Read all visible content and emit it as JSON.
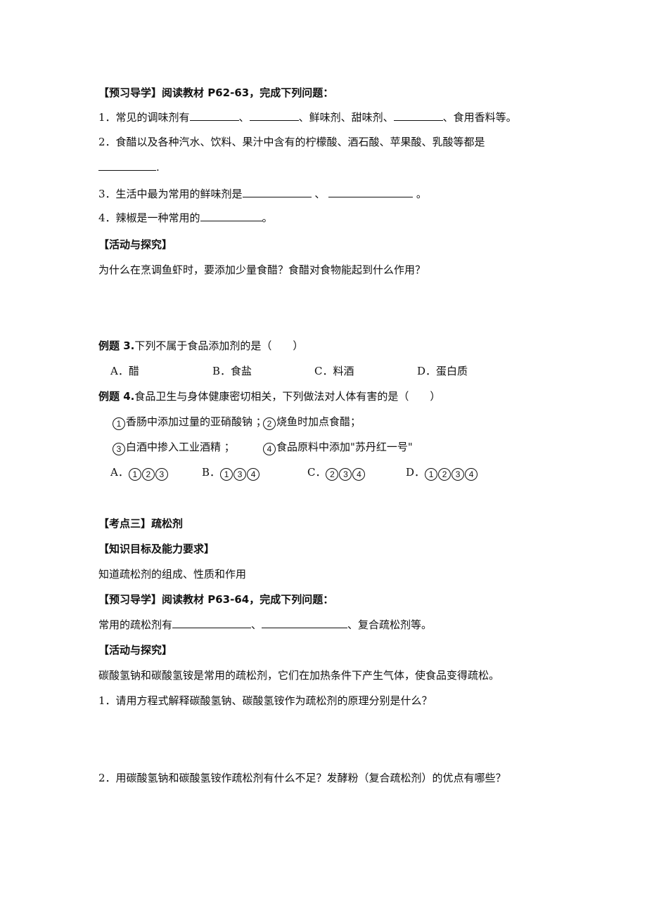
{
  "section1": {
    "preview_heading": "【预习导学】阅读教材 P62-63，完成下列问题：",
    "q1": {
      "prefix": "1．常见的调味剂有",
      "sep1": "、",
      "mid": "、鲜味剂、甜味剂、",
      "suffix": "、食用香料等。"
    },
    "q2": {
      "text": "2．食醋以及各种汽水、饮料、果汁中含有的柠檬酸、酒石酸、苹果酸、乳酸等都是",
      "end": "."
    },
    "q3": {
      "prefix": "3．生活中最为常用的鲜味剂是",
      "sep": " 、 ",
      "end": " 。"
    },
    "q4": {
      "prefix": "4．辣椒是一种常用的",
      "end": "。"
    },
    "activity_heading": "【活动与探究】",
    "activity_question": "为什么在烹调鱼虾时，要添加少量食醋？食醋对食物能起到什么作用？"
  },
  "example3": {
    "label": "例题 3.",
    "question": "下列不属于食品添加剂的是（　　）",
    "options": [
      "A．醋",
      "B．食盐",
      "C．料酒",
      "D．蛋白质"
    ]
  },
  "example4": {
    "label": "例题 4.",
    "question": "食品卫生与身体健康密切相关，下列做法对人体有害的是（　　）",
    "items": [
      {
        "n": "1",
        "text": "香肠中添加过量的亚硝酸钠 ；"
      },
      {
        "n": "2",
        "text": "烧鱼时加点食醋；"
      },
      {
        "n": "3",
        "text": "白酒中掺入工业酒精 ；"
      },
      {
        "n": "4",
        "text": "食品原料中添加\"苏丹红一号\""
      }
    ],
    "options": [
      {
        "letter": "A．",
        "nums": [
          "1",
          "2",
          "3"
        ]
      },
      {
        "letter": "B．",
        "nums": [
          "1",
          "3",
          "4"
        ]
      },
      {
        "letter": "C．",
        "nums": [
          "2",
          "3",
          "4"
        ]
      },
      {
        "letter": "D．",
        "nums": [
          "1",
          "2",
          "3",
          "4"
        ]
      }
    ]
  },
  "section3": {
    "title": "【考点三】疏松剂",
    "goal_heading": "【知识目标及能力要求】",
    "goal_text": "知道疏松剂的组成、性质和作用",
    "preview_heading": "【预习导学】阅读教材 P63-64，完成下列问题：",
    "fill": {
      "prefix": "常用的疏松剂有",
      "sep": "、",
      "suffix": "、复合疏松剂等。"
    },
    "activity_heading": "【活动与探究】",
    "activity_intro": "碳酸氢钠和碳酸氢铵是常用的疏松剂，它们在加热条件下产生气体，使食品变得疏松。",
    "q1": "1．请用方程式解释碳酸氢钠、碳酸氢铵作为疏松剂的原理分别是什么？",
    "q2": "2．用碳酸氢钠和碳酸氢铵作疏松剂有什么不足？发酵粉（复合疏松剂）的优点有哪些？"
  }
}
